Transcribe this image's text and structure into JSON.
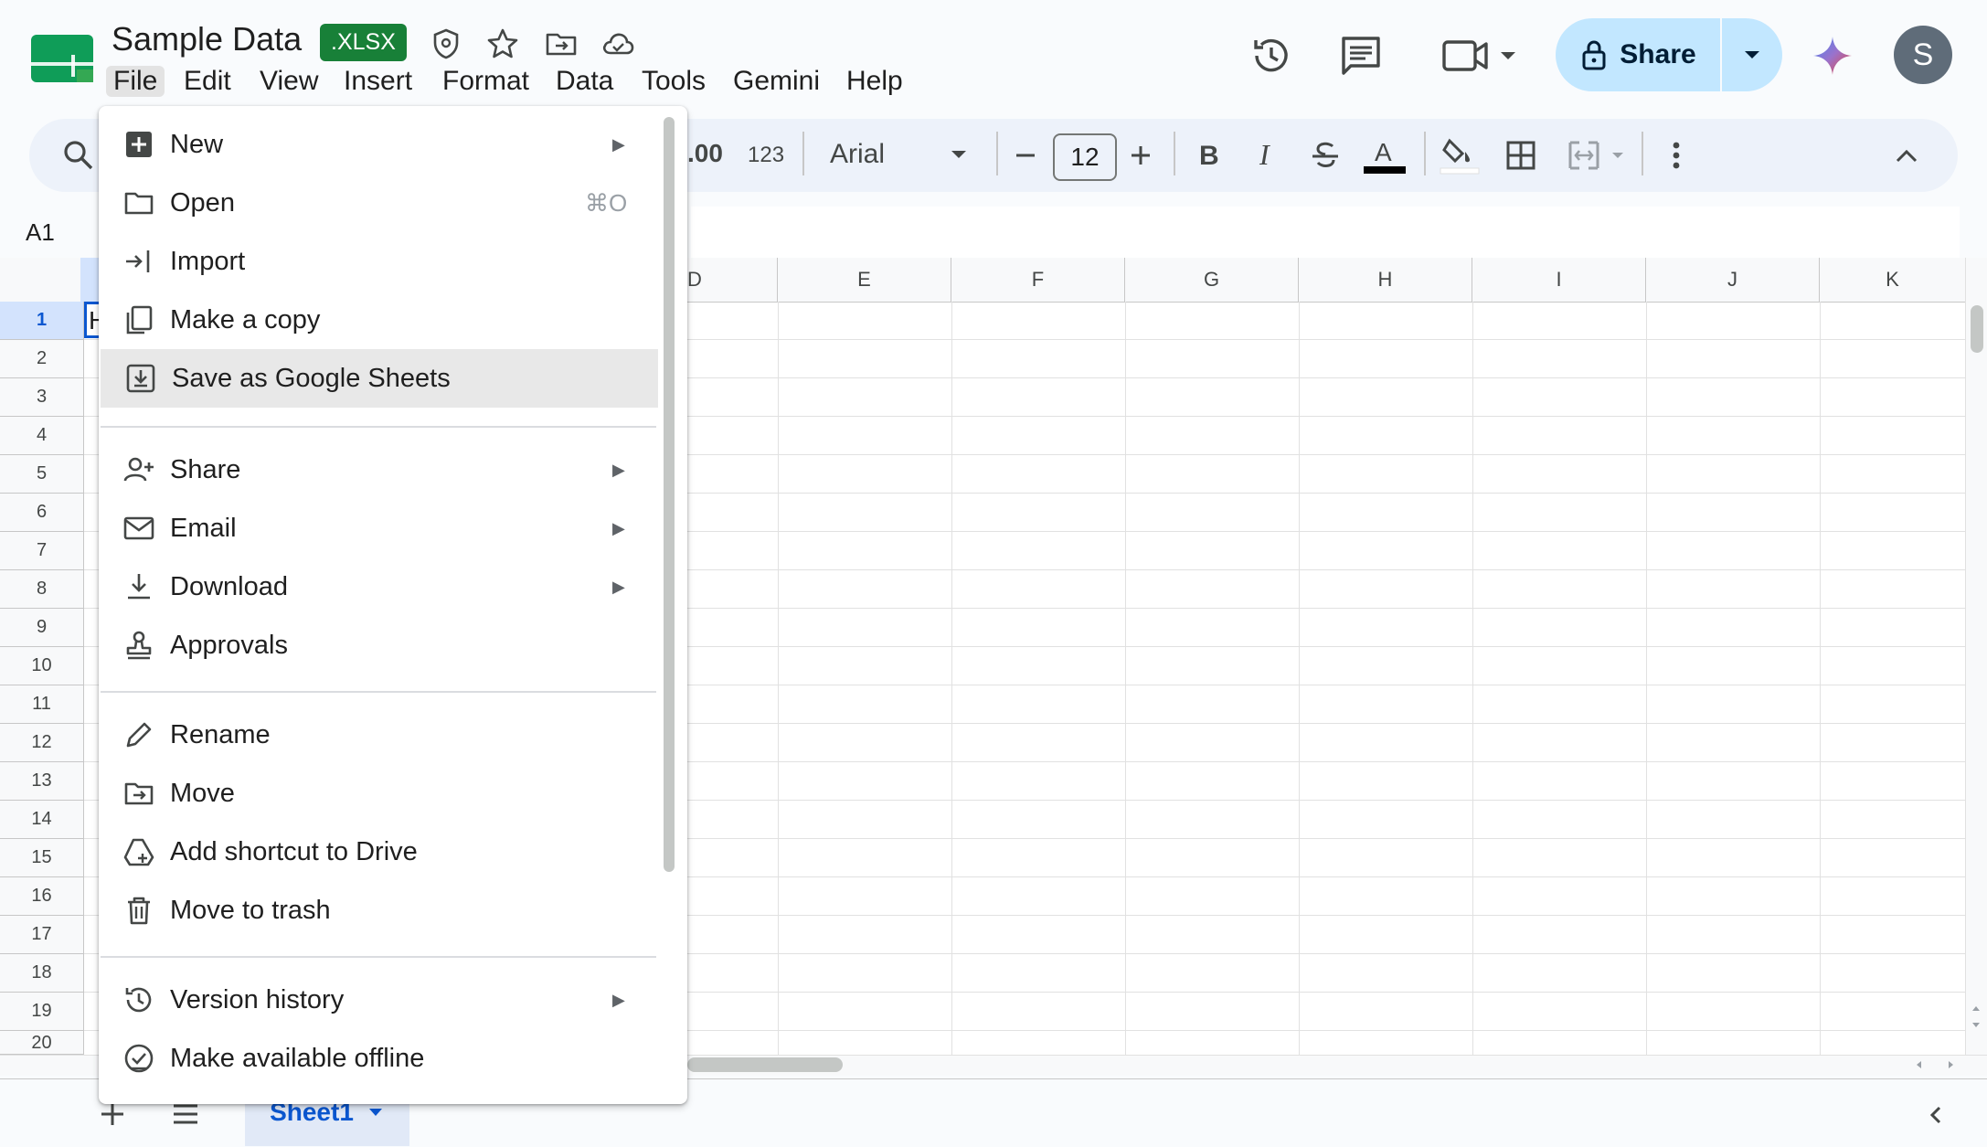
{
  "app": {
    "doc_title": "Sample Data",
    "file_badge": ".XLSX",
    "user_initial": "S"
  },
  "menubar": {
    "items": [
      "File",
      "Edit",
      "View",
      "Insert",
      "Format",
      "Data",
      "Tools",
      "Gemini",
      "Help"
    ],
    "active": "File"
  },
  "header": {
    "share_label": "Share"
  },
  "toolbar": {
    "decimal_label": ".00",
    "format_label": "123",
    "font_name": "Arial",
    "font_size": "12",
    "text_color_label": "A"
  },
  "formula": {
    "name_box": "A1"
  },
  "grid": {
    "visible_columns": [
      "D",
      "E",
      "F",
      "G",
      "H",
      "I",
      "J",
      "K"
    ],
    "rows": [
      "1",
      "2",
      "3",
      "4",
      "5",
      "6",
      "7",
      "8",
      "9",
      "10",
      "11",
      "12",
      "13",
      "14",
      "15",
      "16",
      "17",
      "18",
      "19",
      "20"
    ],
    "selected_row": "1",
    "a1_partial": "H"
  },
  "sheets": {
    "tabs": [
      "Sheet1"
    ],
    "active": "Sheet1"
  },
  "file_menu": {
    "items": [
      {
        "label": "New",
        "icon": "new-sheet-icon",
        "submenu": true
      },
      {
        "label": "Open",
        "icon": "folder-icon",
        "shortcut": "⌘O"
      },
      {
        "label": "Import",
        "icon": "import-icon"
      },
      {
        "label": "Make a copy",
        "icon": "copy-icon"
      },
      {
        "label": "Save as Google Sheets",
        "icon": "save-download-icon",
        "highlighted": true
      },
      {
        "label": "Share",
        "icon": "person-add-icon",
        "submenu": true
      },
      {
        "label": "Email",
        "icon": "mail-icon",
        "submenu": true
      },
      {
        "label": "Download",
        "icon": "download-icon",
        "submenu": true
      },
      {
        "label": "Approvals",
        "icon": "stamp-icon"
      },
      {
        "label": "Rename",
        "icon": "pencil-icon"
      },
      {
        "label": "Move",
        "icon": "folder-move-icon"
      },
      {
        "label": "Add shortcut to Drive",
        "icon": "drive-shortcut-icon"
      },
      {
        "label": "Move to trash",
        "icon": "trash-icon"
      },
      {
        "label": "Version history",
        "icon": "history-icon",
        "submenu": true
      },
      {
        "label": "Make available offline",
        "icon": "offline-check-icon"
      }
    ]
  },
  "colors": {
    "accent": "#0b57d0",
    "share_bg": "#c2e7ff",
    "xlsx_green": "#188038",
    "sheets_green": "#0f9d58"
  }
}
